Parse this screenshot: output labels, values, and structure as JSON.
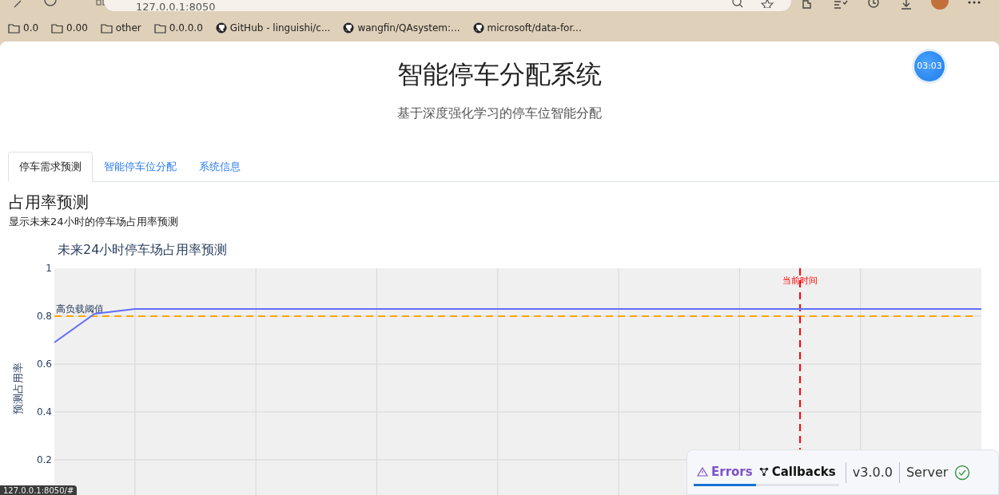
{
  "browser": {
    "url": "127.0.0.1:8050",
    "bookmarks": [
      {
        "kind": "folder",
        "label": "0.0"
      },
      {
        "kind": "folder",
        "label": "0.00"
      },
      {
        "kind": "folder",
        "label": "other"
      },
      {
        "kind": "folder",
        "label": "0.0.0.0"
      },
      {
        "kind": "github",
        "label": "GitHub - linguishi/c..."
      },
      {
        "kind": "github",
        "label": "wangfin/QAsystem:..."
      },
      {
        "kind": "github",
        "label": "microsoft/data-for..."
      }
    ],
    "status_url": "127.0.0.1:8050/#"
  },
  "page": {
    "title": "智能停车分配系统",
    "subtitle": "基于深度强化学习的停车位智能分配",
    "timer": "03:03",
    "tabs": [
      {
        "label": "停车需求预测",
        "selected": true
      },
      {
        "label": "智能停车位分配",
        "selected": false
      },
      {
        "label": "系统信息",
        "selected": false
      }
    ],
    "section": {
      "heading": "占用率预测",
      "description": "显示未来24小时的停车场占用率预测"
    },
    "chart_data": {
      "type": "line",
      "title": "未来24小时停车场占用率预测",
      "ylabel": "预测占用率",
      "categories": [
        null,
        null,
        null,
        null,
        null,
        null,
        null,
        null,
        null,
        null,
        null,
        null,
        null,
        null,
        null,
        null,
        null,
        null,
        null,
        null,
        null,
        null,
        null,
        null
      ],
      "series": [
        {
          "color": "#636efa",
          "values": [
            0.69,
            0.81,
            0.83,
            0.83,
            0.83,
            0.83,
            0.83,
            0.83,
            0.83,
            0.83,
            0.83,
            0.83,
            0.83,
            0.83,
            0.83,
            0.83,
            0.83,
            0.83,
            0.83,
            0.83,
            0.83,
            0.83,
            0.83,
            0.83
          ]
        }
      ],
      "ylim": [
        0,
        1
      ],
      "grid": true,
      "yticks": [
        {
          "value": 0.2,
          "label": "0.2"
        },
        {
          "value": 0.4,
          "label": "0.4"
        },
        {
          "value": 0.6,
          "label": "0.6"
        },
        {
          "value": 0.8,
          "label": "0.8"
        },
        {
          "value": 1,
          "label": "1"
        }
      ],
      "ref_lines": [
        {
          "axis": "y",
          "value": 0.8,
          "label": "高负载阈值"
        }
      ]
    },
    "current_time_marker": {
      "label": "当前时间"
    }
  },
  "debug_bar": {
    "tabs": [
      {
        "kind": "errors",
        "label": "Errors",
        "selected": true
      },
      {
        "kind": "callbacks",
        "label": "Callbacks",
        "selected": false
      }
    ],
    "version": "v3.0.0",
    "server": {
      "label": "Server",
      "ok": true
    }
  }
}
